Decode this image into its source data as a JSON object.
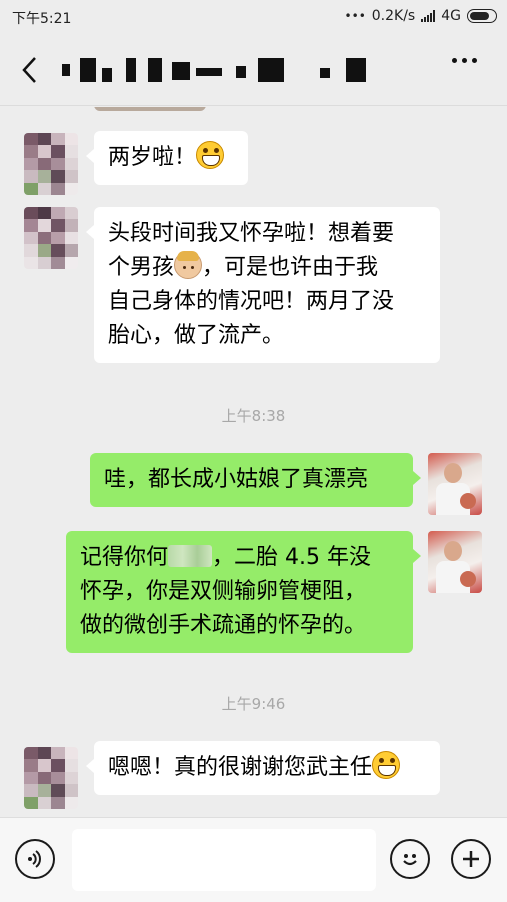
{
  "status_bar": {
    "time": "下午5:21",
    "dots": "•••",
    "network_speed": "0.2K/s",
    "network_type": "4G"
  },
  "nav": {
    "back_icon": "chevron-left-icon",
    "title_redacted": true,
    "more_icon": "more-dots-icon"
  },
  "messages": [
    {
      "id": "m1",
      "side": "in",
      "lines": [
        "两岁啦！"
      ],
      "emoji": "grinning-face"
    },
    {
      "id": "m2",
      "side": "in",
      "lines": [
        "头段时间我又怀孕啦！想着要",
        "个男孩",
        "，可是也许由于我",
        "自己身体的情况吧！两月了没",
        "胎心，做了流产。"
      ],
      "emoji": "boy"
    },
    {
      "id": "ts1",
      "type": "timestamp",
      "text": "上午8:38"
    },
    {
      "id": "m3",
      "side": "out",
      "lines": [
        "哇，都长成小姑娘了真漂亮"
      ]
    },
    {
      "id": "m4",
      "side": "out",
      "lines": [
        "记得你何",
        "，二胎 4.5 年没",
        "怀孕，你是双侧输卵管梗阻，",
        "做的微创手术疏通的怀孕的。"
      ],
      "name_blurred": true
    },
    {
      "id": "ts2",
      "type": "timestamp",
      "text": "上午9:46"
    },
    {
      "id": "m5",
      "side": "in",
      "lines": [
        "嗯嗯！真的很谢谢您武主任"
      ],
      "emoji": "grinning-face"
    }
  ],
  "input_bar": {
    "voice_icon": "voice-icon",
    "input_value": "",
    "emoji_icon": "smiley-icon",
    "plus_icon": "plus-icon"
  },
  "colors": {
    "background": "#ededed",
    "incoming_bubble": "#ffffff",
    "outgoing_bubble": "#95ec69",
    "timestamp_text": "#a8a8a8"
  }
}
